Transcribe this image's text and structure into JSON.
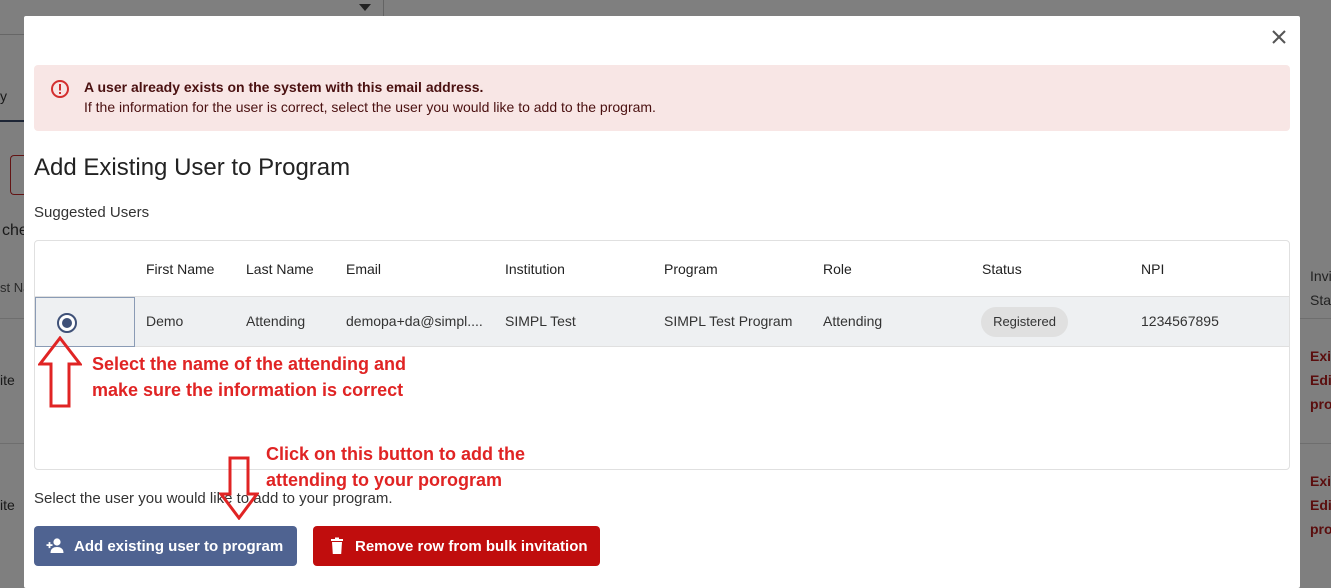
{
  "background": {
    "tab_fragment": "y",
    "text_fragment_1": "che",
    "text_fragment_2": "st Na",
    "text_fragment_3": "ite",
    "text_fragment_4": "ite",
    "right_col": {
      "header_1": "Invi",
      "header_2": "Sta",
      "row1": [
        "Exi",
        "Edi",
        "pro"
      ],
      "row2": [
        "Exi",
        "Edi",
        "pro"
      ]
    }
  },
  "alert": {
    "title": "A user already exists on the system with this email address.",
    "message": "If the information for the user is correct, select the user you would like to add to the program."
  },
  "modal": {
    "title": "Add Existing User to Program",
    "suggested_label": "Suggested Users",
    "helper_text": "Select the user you would like to add to your program."
  },
  "table": {
    "headers": {
      "first_name": "First Name",
      "last_name": "Last Name",
      "email": "Email",
      "institution": "Institution",
      "program": "Program",
      "role": "Role",
      "status": "Status",
      "npi": "NPI"
    },
    "rows": [
      {
        "first_name": "Demo",
        "last_name": "Attending",
        "email": "demopa+da@simpl....",
        "institution": "SIMPL Test",
        "program": "SIMPL Test Program",
        "role": "Attending",
        "status": "Registered",
        "npi": "1234567895"
      }
    ]
  },
  "buttons": {
    "add_existing": "Add existing user to program",
    "remove_row": "Remove row from bulk invitation"
  },
  "annotations": {
    "select_line1": "Select the name of the attending and",
    "select_line2": "make sure the information is correct",
    "click_line1": "Click on this button to add the",
    "click_line2": "attending to your porogram"
  },
  "colors": {
    "primary": "#4f6391",
    "danger": "#c00d0d",
    "alert_bg": "#f8e6e5",
    "annotation": "#e02424"
  },
  "icons": [
    "close-icon",
    "alert-circle-icon",
    "add-user-icon",
    "trash-icon",
    "arrow-up-icon",
    "arrow-down-icon"
  ]
}
